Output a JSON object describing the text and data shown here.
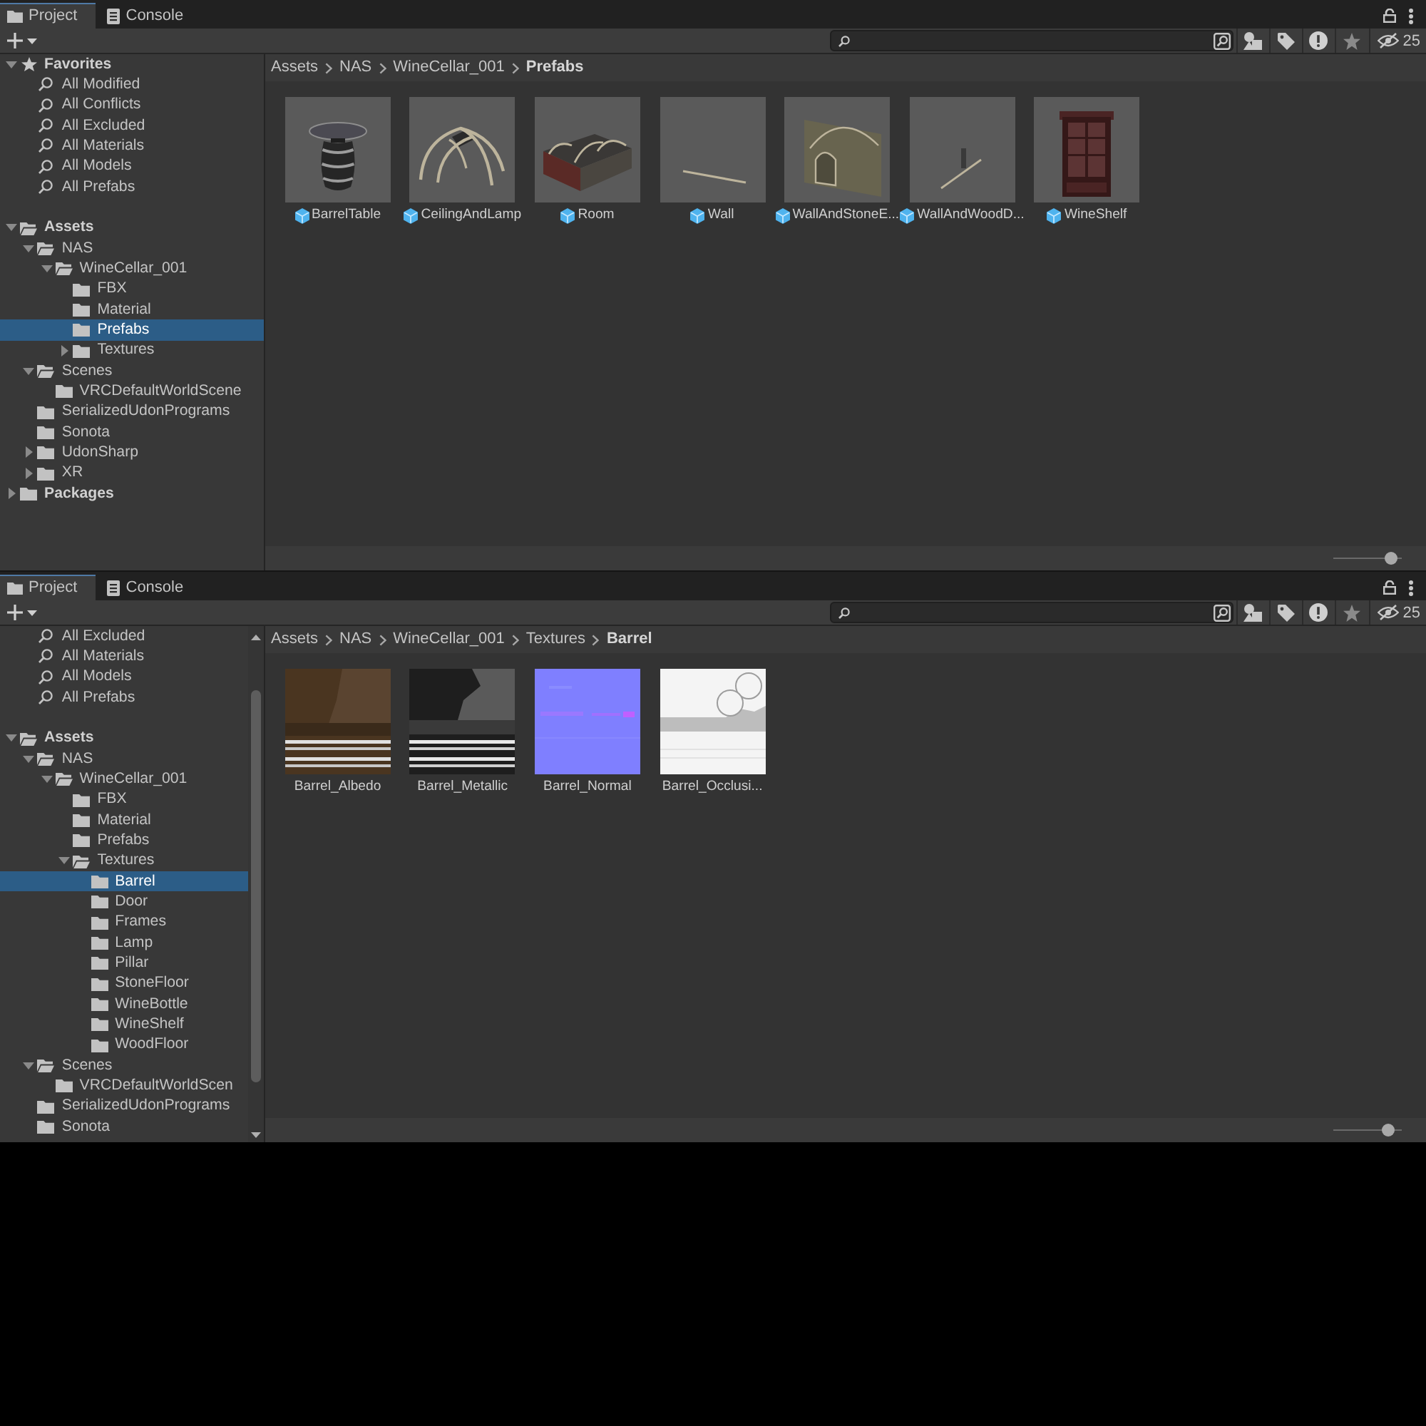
{
  "panels": [
    {
      "tabs": [
        {
          "kind": "project",
          "label": "Project",
          "selected": true
        },
        {
          "kind": "console",
          "label": "Console",
          "selected": false
        }
      ],
      "hidden_packages_count": "25",
      "tree": {
        "items": [
          {
            "kind": "favorites",
            "label": "Favorites",
            "expandable": true,
            "expanded": true,
            "selected": false,
            "children": [
              {
                "kind": "search",
                "label": "All Modified",
                "expandable": false,
                "selected": false
              },
              {
                "kind": "search",
                "label": "All Conflicts",
                "expandable": false,
                "selected": false
              },
              {
                "kind": "search",
                "label": "All Excluded",
                "expandable": false,
                "selected": false
              },
              {
                "kind": "search",
                "label": "All Materials",
                "expandable": false,
                "selected": false
              },
              {
                "kind": "search",
                "label": "All Models",
                "expandable": false,
                "selected": false
              },
              {
                "kind": "search",
                "label": "All Prefabs",
                "expandable": false,
                "selected": false
              }
            ]
          },
          {
            "kind": "folder",
            "label": "Assets",
            "expandable": true,
            "expanded": true,
            "selected": false,
            "children": [
              {
                "kind": "folder",
                "label": "NAS",
                "expandable": true,
                "expanded": true,
                "selected": false,
                "children": [
                  {
                    "kind": "folder",
                    "label": "WineCellar_001",
                    "expandable": true,
                    "expanded": true,
                    "selected": false,
                    "children": [
                      {
                        "kind": "folder",
                        "label": "FBX",
                        "expandable": false,
                        "expanded": false,
                        "selected": false
                      },
                      {
                        "kind": "folder",
                        "label": "Material",
                        "expandable": false,
                        "expanded": false,
                        "selected": false
                      },
                      {
                        "kind": "folder",
                        "label": "Prefabs",
                        "expandable": false,
                        "expanded": false,
                        "selected": true
                      },
                      {
                        "kind": "folder",
                        "label": "Textures",
                        "expandable": true,
                        "expanded": false,
                        "selected": false
                      }
                    ]
                  }
                ]
              },
              {
                "kind": "folder",
                "label": "Scenes",
                "expandable": true,
                "expanded": true,
                "selected": false,
                "children": [
                  {
                    "kind": "folder",
                    "label": "VRCDefaultWorldScene",
                    "expandable": false,
                    "expanded": false,
                    "selected": false
                  }
                ]
              },
              {
                "kind": "folder",
                "label": "SerializedUdonPrograms",
                "expandable": false,
                "expanded": false,
                "selected": false
              },
              {
                "kind": "folder",
                "label": "Sonota",
                "expandable": false,
                "expanded": false,
                "selected": false
              },
              {
                "kind": "folder",
                "label": "UdonSharp",
                "expandable": true,
                "expanded": false,
                "selected": false
              },
              {
                "kind": "folder",
                "label": "XR",
                "expandable": true,
                "expanded": false,
                "selected": false
              }
            ]
          },
          {
            "kind": "folder",
            "label": "Packages",
            "expandable": true,
            "expanded": false,
            "selected": false
          }
        ]
      },
      "breadcrumb": [
        "Assets",
        "NAS",
        "WineCellar_001",
        "Prefabs"
      ],
      "assets": [
        {
          "kind": "prefab",
          "name": "BarrelTable"
        },
        {
          "kind": "prefab",
          "name": "CeilingAndLamp"
        },
        {
          "kind": "prefab",
          "name": "Room"
        },
        {
          "kind": "prefab",
          "name": "Wall"
        },
        {
          "kind": "prefab",
          "name": "WallAndStoneE..."
        },
        {
          "kind": "prefab",
          "name": "WallAndWoodD..."
        },
        {
          "kind": "prefab",
          "name": "WineShelf"
        }
      ],
      "zoom_slider": {
        "level": 0.85
      }
    },
    {
      "tabs": [
        {
          "kind": "project",
          "label": "Project",
          "selected": true
        },
        {
          "kind": "console",
          "label": "Console",
          "selected": false
        }
      ],
      "hidden_packages_count": "25",
      "tree": {
        "scrollbar": true,
        "items": [
          {
            "kind": "favorites",
            "children": [
              {
                "kind": "search",
                "label": "All Excluded",
                "expandable": false,
                "selected": false
              },
              {
                "kind": "search",
                "label": "All Materials",
                "expandable": false,
                "selected": false
              },
              {
                "kind": "search",
                "label": "All Models",
                "expandable": false,
                "selected": false
              },
              {
                "kind": "search",
                "label": "All Prefabs",
                "expandable": false,
                "selected": false
              }
            ]
          },
          {
            "kind": "folder",
            "label": "Assets",
            "expandable": true,
            "expanded": true,
            "selected": false,
            "children": [
              {
                "kind": "folder",
                "label": "NAS",
                "expandable": true,
                "expanded": true,
                "selected": false,
                "children": [
                  {
                    "kind": "folder",
                    "label": "WineCellar_001",
                    "expandable": true,
                    "expanded": true,
                    "selected": false,
                    "children": [
                      {
                        "kind": "folder",
                        "label": "FBX",
                        "expandable": false,
                        "expanded": false,
                        "selected": false
                      },
                      {
                        "kind": "folder",
                        "label": "Material",
                        "expandable": false,
                        "expanded": false,
                        "selected": false
                      },
                      {
                        "kind": "folder",
                        "label": "Prefabs",
                        "expandable": false,
                        "expanded": false,
                        "selected": false
                      },
                      {
                        "kind": "folder",
                        "label": "Textures",
                        "expandable": true,
                        "expanded": true,
                        "selected": false,
                        "children": [
                          {
                            "kind": "folder",
                            "label": "Barrel",
                            "expandable": false,
                            "expanded": false,
                            "selected": true
                          },
                          {
                            "kind": "folder",
                            "label": "Door",
                            "expandable": false,
                            "expanded": false,
                            "selected": false
                          },
                          {
                            "kind": "folder",
                            "label": "Frames",
                            "expandable": false,
                            "expanded": false,
                            "selected": false
                          },
                          {
                            "kind": "folder",
                            "label": "Lamp",
                            "expandable": false,
                            "expanded": false,
                            "selected": false
                          },
                          {
                            "kind": "folder",
                            "label": "Pillar",
                            "expandable": false,
                            "expanded": false,
                            "selected": false
                          },
                          {
                            "kind": "folder",
                            "label": "StoneFloor",
                            "expandable": false,
                            "expanded": false,
                            "selected": false
                          },
                          {
                            "kind": "folder",
                            "label": "WineBottle",
                            "expandable": false,
                            "expanded": false,
                            "selected": false
                          },
                          {
                            "kind": "folder",
                            "label": "WineShelf",
                            "expandable": false,
                            "expanded": false,
                            "selected": false
                          },
                          {
                            "kind": "folder",
                            "label": "WoodFloor",
                            "expandable": false,
                            "expanded": false,
                            "selected": false
                          }
                        ]
                      }
                    ]
                  }
                ]
              },
              {
                "kind": "folder",
                "label": "Scenes",
                "expandable": true,
                "expanded": true,
                "selected": false,
                "children": [
                  {
                    "kind": "folder",
                    "label": "VRCDefaultWorldScen",
                    "expandable": false,
                    "expanded": false,
                    "selected": false
                  }
                ]
              },
              {
                "kind": "folder",
                "label": "SerializedUdonPrograms",
                "expandable": false,
                "expanded": false,
                "selected": false
              },
              {
                "kind": "folder",
                "label": "Sonota",
                "expandable": false,
                "expanded": false,
                "selected": false
              }
            ]
          }
        ]
      },
      "breadcrumb": [
        "Assets",
        "NAS",
        "WineCellar_001",
        "Textures",
        "Barrel"
      ],
      "assets": [
        {
          "kind": "texture",
          "name": "Barrel_Albedo"
        },
        {
          "kind": "texture",
          "name": "Barrel_Metallic"
        },
        {
          "kind": "texture",
          "name": "Barrel_Normal"
        },
        {
          "kind": "texture",
          "name": "Barrel_Occlusi..."
        }
      ],
      "zoom_slider": {
        "level": 0.8
      }
    }
  ]
}
